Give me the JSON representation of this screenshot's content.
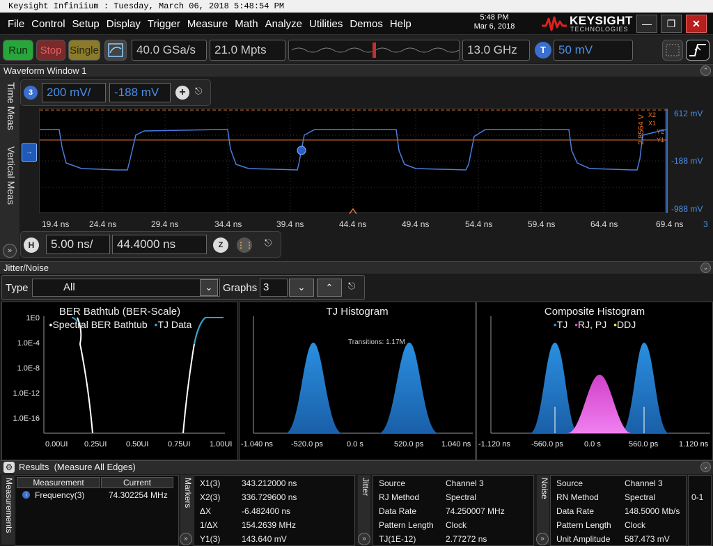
{
  "window": {
    "title": "Keysight Infiniium : Tuesday, March 06, 2018 5:48:54 PM"
  },
  "menu": [
    "File",
    "Control",
    "Setup",
    "Display",
    "Trigger",
    "Measure",
    "Math",
    "Analyze",
    "Utilities",
    "Demos",
    "Help"
  ],
  "clock": {
    "time": "5:48 PM",
    "date": "Mar 6, 2018"
  },
  "brand": {
    "name": "KEYSIGHT",
    "sub": "TECHNOLOGIES"
  },
  "toolbar": {
    "run": "Run",
    "stop": "Stop",
    "single": "Single",
    "sample_rate": "40.0 GSa/s",
    "memory_depth": "21.0 Mpts",
    "bandwidth": "13.0 GHz",
    "trigger_badge": "T",
    "trigger_level": "50 mV"
  },
  "waveform_window": {
    "title": "Waveform Window 1",
    "side_tabs": [
      "Time Meas",
      "Vertical Meas"
    ],
    "channel_badge": "3",
    "scale": "200 mV/",
    "offset": "-188 mV",
    "time_ticks": [
      "19.4 ns",
      "24.4 ns",
      "29.4 ns",
      "34.4 ns",
      "39.4 ns",
      "44.4 ns",
      "49.4 ns",
      "54.4 ns",
      "59.4 ns",
      "64.4 ns",
      "69.4 ns"
    ],
    "channel_mark": "3",
    "volt_labels": [
      "612 mV",
      "-188 mV",
      "-988 mV"
    ],
    "marker_readout": "2.8564 V",
    "marker_tags": [
      "X2",
      "X1",
      "Y2",
      "Y1"
    ],
    "horizontal": {
      "badge": "H",
      "scale": "5.00 ns/",
      "position": "44.4000 ns",
      "zoom_badge": "Z"
    }
  },
  "jitter": {
    "title": "Jitter/Noise",
    "type_label": "Type",
    "type_value": "All",
    "graphs_label": "Graphs",
    "graphs_value": "3",
    "charts": [
      {
        "title": "BER Bathtub (BER-Scale)",
        "legend": [
          "Spectral BER Bathtub",
          "TJ Data"
        ],
        "y_ticks": [
          "1E0",
          "1.0E-4",
          "1.0E-8",
          "1.0E-12",
          "1.0E-16"
        ],
        "x_ticks": [
          "0.00UI",
          "0.25UI",
          "0.50UI",
          "0.75UI",
          "1.00UI"
        ]
      },
      {
        "title": "TJ Histogram",
        "annotation": "Transitions: 1.17M",
        "x_ticks": [
          "-1.040 ns",
          "-520.0 ps",
          "0.0 s",
          "520.0 ps",
          "1.040 ns"
        ]
      },
      {
        "title": "Composite Histogram",
        "legend": [
          "TJ",
          "RJ, PJ",
          "DDJ"
        ],
        "x_ticks": [
          "-1.120 ns",
          "-560.0 ps",
          "0.0 s",
          "560.0 ps",
          "1.120 ns"
        ]
      }
    ]
  },
  "results": {
    "title": "Results",
    "subtitle": "(Measure All Edges)",
    "measurement_header": "Measurement",
    "current_header": "Current",
    "measurements": [
      {
        "name": "Frequency(3)",
        "current": "74.302254 MHz"
      }
    ],
    "markers_label": "Markers",
    "markers": [
      {
        "k": "X1(3)",
        "v": "343.212000 ns"
      },
      {
        "k": "X2(3)",
        "v": "336.729600 ns"
      },
      {
        "k": "ΔX",
        "v": "-6.482400 ns"
      },
      {
        "k": "1/ΔX",
        "v": "154.2639 MHz"
      },
      {
        "k": "Y1(3)",
        "v": "143.640 mV"
      }
    ],
    "jitter_label": "Jitter",
    "jitter_rows": [
      {
        "k": "Source",
        "v": "Channel 3"
      },
      {
        "k": "RJ Method",
        "v": "Spectral"
      },
      {
        "k": "Data Rate",
        "v": "74.250007 MHz"
      },
      {
        "k": "Pattern Length",
        "v": "Clock"
      },
      {
        "k": "TJ(1E-12)",
        "v": "2.77272 ns"
      }
    ],
    "noise_label": "Noise",
    "noise_rows": [
      {
        "k": "Source",
        "v": "Channel 3"
      },
      {
        "k": "RN Method",
        "v": "Spectral"
      },
      {
        "k": "Data Rate",
        "v": "148.5000 Mb/s"
      },
      {
        "k": "Pattern Length",
        "v": "Clock"
      },
      {
        "k": "Unit Amplitude",
        "v": "587.473 mV"
      }
    ],
    "side_value": "0-1"
  },
  "colors": {
    "waveform": "#4b7de0",
    "marker": "#e8742a",
    "tj": "#2a8fe0",
    "rj": "#e040d0",
    "ddj": "#f0e040",
    "bathtub_tj": "#2aa0d8"
  }
}
